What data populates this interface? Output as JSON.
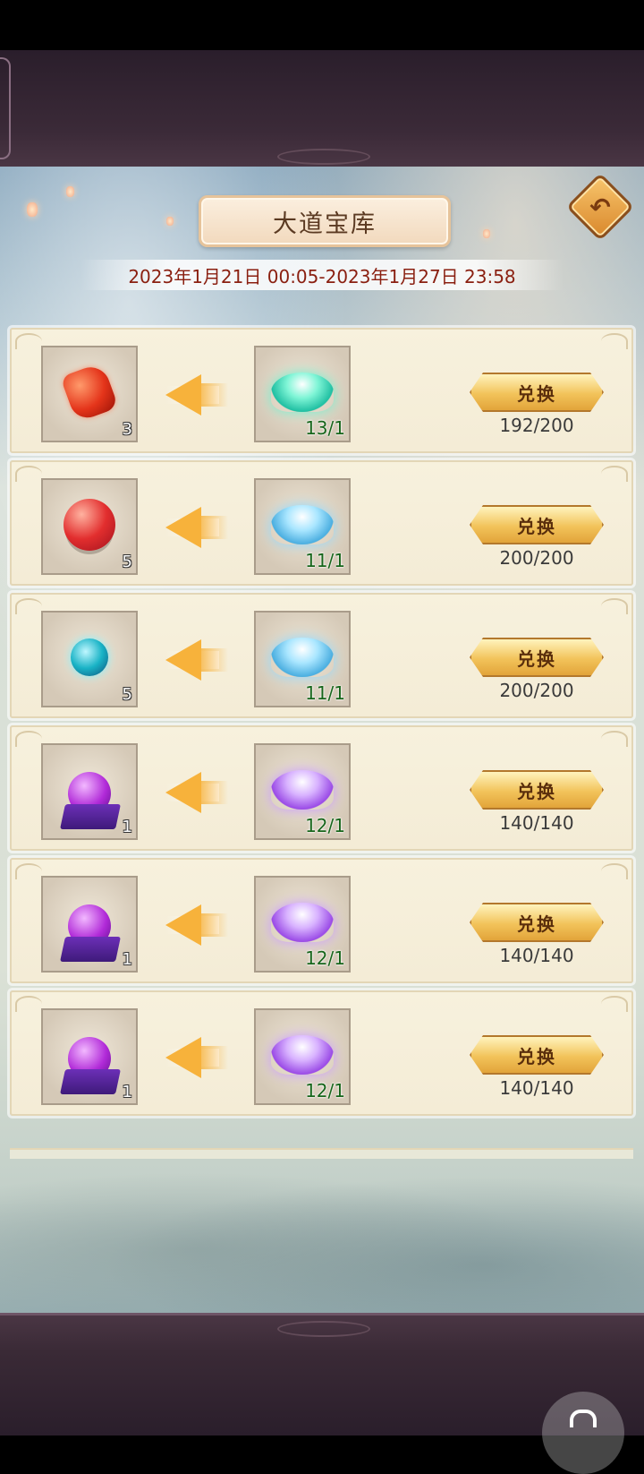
{
  "title": "大道宝库",
  "date_range": "2023年1月21日 00:05-2023年1月27日 23:58",
  "exchange_label": "兑换",
  "rows": [
    {
      "cost_item": "red-gem",
      "cost_count": "3",
      "reward_item": "green-lotus",
      "reward_ratio": "13/1",
      "stock": "192/200"
    },
    {
      "cost_item": "red-orb",
      "cost_count": "5",
      "reward_item": "blue-lotus",
      "reward_ratio": "11/1",
      "stock": "200/200"
    },
    {
      "cost_item": "teal-orb",
      "cost_count": "5",
      "reward_item": "blue-lotus",
      "reward_ratio": "11/1",
      "stock": "200/200"
    },
    {
      "cost_item": "purple-orb-pedestal",
      "cost_count": "1",
      "reward_item": "purple-lotus",
      "reward_ratio": "12/1",
      "stock": "140/140"
    },
    {
      "cost_item": "purple-orb-pedestal",
      "cost_count": "1",
      "reward_item": "purple-lotus",
      "reward_ratio": "12/1",
      "stock": "140/140"
    },
    {
      "cost_item": "purple-orb-pedestal",
      "cost_count": "1",
      "reward_item": "purple-lotus",
      "reward_ratio": "12/1",
      "stock": "140/140"
    }
  ],
  "icons": {
    "back": "back-arrow-icon",
    "lock": "lock-icon"
  }
}
